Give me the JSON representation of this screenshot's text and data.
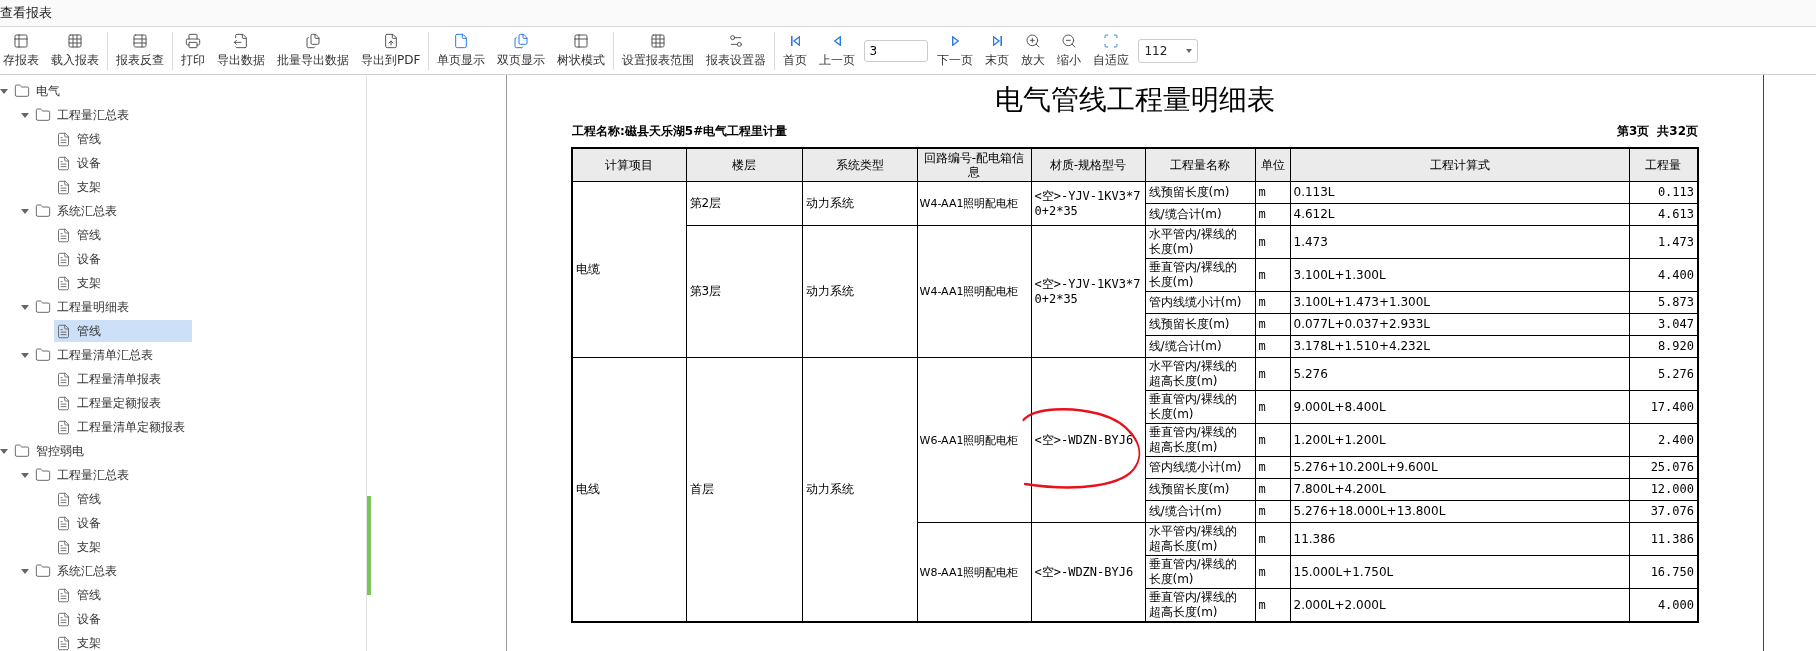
{
  "window": {
    "title": "查看报表"
  },
  "toolbar": [
    [
      {
        "label": "存报表",
        "kind": "table-save"
      },
      {
        "label": "载入报表",
        "kind": "table-load"
      }
    ],
    [
      {
        "label": "报表反查",
        "kind": "table-back"
      }
    ],
    [
      {
        "label": "打印",
        "kind": "print"
      },
      {
        "label": "导出数据",
        "kind": "export"
      },
      {
        "label": "批量导出数据",
        "kind": "batch-export"
      },
      {
        "label": "导出到PDF",
        "kind": "pdf"
      }
    ],
    [
      {
        "label": "单页显示",
        "kind": "page"
      },
      {
        "label": "双页显示",
        "kind": "pages"
      },
      {
        "label": "树状模式",
        "kind": "grid"
      }
    ],
    [
      {
        "label": "设置报表范围",
        "kind": "range"
      },
      {
        "label": "报表设置器",
        "kind": "settings"
      }
    ],
    [
      {
        "label": "首页",
        "kind": "first"
      },
      {
        "label": "上一页",
        "kind": "prev"
      },
      {
        "kind": "page-input",
        "value": "3"
      },
      {
        "label": "下一页",
        "kind": "next"
      },
      {
        "label": "末页",
        "kind": "last"
      },
      {
        "label": "放大",
        "kind": "zoom-in"
      },
      {
        "label": "缩小",
        "kind": "zoom-out"
      },
      {
        "label": "自适应",
        "kind": "fit"
      },
      {
        "kind": "select",
        "value": "112"
      }
    ]
  ],
  "tree": [
    {
      "label": "电气",
      "kind": "folder",
      "expanded": true,
      "selected": false,
      "children": [
        {
          "label": "工程量汇总表",
          "kind": "folder",
          "expanded": true,
          "selected": false,
          "children": [
            {
              "label": "管线",
              "kind": "report",
              "selected": false
            },
            {
              "label": "设备",
              "kind": "report",
              "selected": false
            },
            {
              "label": "支架",
              "kind": "report",
              "selected": false
            }
          ]
        },
        {
          "label": "系统汇总表",
          "kind": "folder",
          "expanded": true,
          "selected": false,
          "children": [
            {
              "label": "管线",
              "kind": "report",
              "selected": false
            },
            {
              "label": "设备",
              "kind": "report",
              "selected": false
            },
            {
              "label": "支架",
              "kind": "report",
              "selected": false
            }
          ]
        },
        {
          "label": "工程量明细表",
          "kind": "folder",
          "expanded": true,
          "selected": false,
          "children": [
            {
              "label": "管线",
              "kind": "report",
              "selected": true
            }
          ]
        },
        {
          "label": "工程量清单汇总表",
          "kind": "folder",
          "expanded": true,
          "selected": false,
          "children": [
            {
              "label": "工程量清单报表",
              "kind": "report",
              "selected": false
            },
            {
              "label": "工程量定额报表",
              "kind": "report",
              "selected": false
            },
            {
              "label": "工程量清单定额报表",
              "kind": "report",
              "selected": false
            }
          ]
        }
      ]
    },
    {
      "label": "智控弱电",
      "kind": "folder",
      "expanded": true,
      "selected": false,
      "children": [
        {
          "label": "工程量汇总表",
          "kind": "folder",
          "expanded": true,
          "selected": false,
          "children": [
            {
              "label": "管线",
              "kind": "report",
              "selected": false
            },
            {
              "label": "设备",
              "kind": "report",
              "selected": false
            },
            {
              "label": "支架",
              "kind": "report",
              "selected": false
            }
          ]
        },
        {
          "label": "系统汇总表",
          "kind": "folder",
          "expanded": true,
          "selected": false,
          "children": [
            {
              "label": "管线",
              "kind": "report",
              "selected": false
            },
            {
              "label": "设备",
              "kind": "report",
              "selected": false
            },
            {
              "label": "支架",
              "kind": "report",
              "selected": false
            }
          ]
        }
      ]
    }
  ],
  "report": {
    "title": "电气管线工程量明细表",
    "project": "工程名称:磁县天乐湖5#电气工程里计量",
    "page": "第3页",
    "total": "共32页",
    "columns": [
      "计算项目",
      "楼层",
      "系统类型",
      "回路编号-配电箱信息",
      "材质-规格型号",
      "工程量名称",
      "单位",
      "工程计算式",
      "工程量"
    ],
    "items": [
      {
        "item": "电缆",
        "floors": [
          {
            "floor": "第2层",
            "system": "动力系统",
            "circuits": [
              {
                "circuit": "W4-AA1照明配电柜",
                "material": "<空>-YJV-1KV3*70+2*35",
                "lines": [
                  {
                    "name": "线预留长度(m)",
                    "unit": "m",
                    "formula": "0.113L",
                    "qty": "0.113"
                  },
                  {
                    "name": "线/缆合计(m)",
                    "unit": "m",
                    "formula": "4.612L",
                    "qty": "4.613"
                  }
                ]
              }
            ]
          },
          {
            "floor": "第3层",
            "system": "动力系统",
            "circuits": [
              {
                "circuit": "W4-AA1照明配电柜",
                "material": "<空>-YJV-1KV3*70+2*35",
                "lines": [
                  {
                    "name": "水平管内/裸线的长度(m)",
                    "unit": "m",
                    "formula": "1.473",
                    "qty": "1.473"
                  },
                  {
                    "name": "垂直管内/裸线的长度(m)",
                    "unit": "m",
                    "formula": "3.100L+1.300L",
                    "qty": "4.400"
                  },
                  {
                    "name": "管内线缆小计(m)",
                    "unit": "m",
                    "formula": "3.100L+1.473+1.300L",
                    "qty": "5.873"
                  },
                  {
                    "name": "线预留长度(m)",
                    "unit": "m",
                    "formula": "0.077L+0.037+2.933L",
                    "qty": "3.047"
                  },
                  {
                    "name": "线/缆合计(m)",
                    "unit": "m",
                    "formula": "3.178L+1.510+4.232L",
                    "qty": "8.920"
                  }
                ]
              }
            ]
          }
        ]
      },
      {
        "item": "电线",
        "floors": [
          {
            "floor": "首层",
            "system": "动力系统",
            "circuits": [
              {
                "circuit": "W6-AA1照明配电柜",
                "material": "<空>-WDZN-BYJ6",
                "lines": [
                  {
                    "name": "水平管内/裸线的超高长度(m)",
                    "unit": "m",
                    "formula": "5.276",
                    "qty": "5.276"
                  },
                  {
                    "name": "垂直管内/裸线的长度(m)",
                    "unit": "m",
                    "formula": "9.000L+8.400L",
                    "qty": "17.400"
                  },
                  {
                    "name": "垂直管内/裸线的超高长度(m)",
                    "unit": "m",
                    "formula": "1.200L+1.200L",
                    "qty": "2.400"
                  },
                  {
                    "name": "管内线缆小计(m)",
                    "unit": "m",
                    "formula": "5.276+10.200L+9.600L",
                    "qty": "25.076"
                  },
                  {
                    "name": "线预留长度(m)",
                    "unit": "m",
                    "formula": "7.800L+4.200L",
                    "qty": "12.000"
                  },
                  {
                    "name": "线/缆合计(m)",
                    "unit": "m",
                    "formula": "5.276+18.000L+13.800L",
                    "qty": "37.076"
                  }
                ]
              },
              {
                "circuit": "W8-AA1照明配电柜",
                "material": "<空>-WDZN-BYJ6",
                "lines": [
                  {
                    "name": "水平管内/裸线的超高长度(m)",
                    "unit": "m",
                    "formula": "11.386",
                    "qty": "11.386"
                  },
                  {
                    "name": "垂直管内/裸线的长度(m)",
                    "unit": "m",
                    "formula": "15.000L+1.750L",
                    "qty": "16.750"
                  },
                  {
                    "name": "垂直管内/裸线的超高长度(m)",
                    "unit": "m",
                    "formula": "2.000L+2.000L",
                    "qty": "4.000"
                  }
                ]
              }
            ]
          }
        ]
      }
    ]
  }
}
